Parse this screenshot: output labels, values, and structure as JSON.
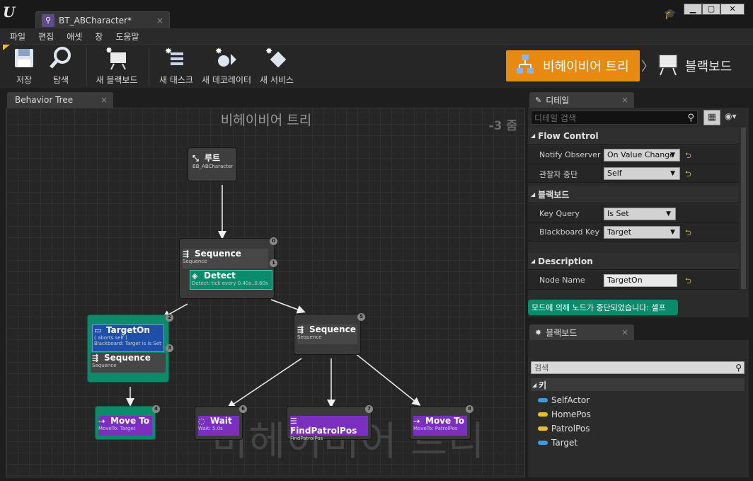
{
  "window": {
    "doc_tab": "BT_ABCharacter*",
    "doc_tab_close": "×",
    "buttons": [
      "▁",
      "▢",
      "✕"
    ]
  },
  "menu": [
    "파일",
    "편집",
    "애셋",
    "창",
    "도움말"
  ],
  "toolbar": {
    "save": "저장",
    "browse": "탐색",
    "new_blackboard": "새 블랙보드",
    "new_task": "새 태스크",
    "new_decorator": "새 데코레이터",
    "new_service": "새 서비스"
  },
  "modes": {
    "behavior_tree": "비헤이비어 트리",
    "blackboard": "블랙보드",
    "arrow": "〉"
  },
  "graph": {
    "tab": "Behavior Tree",
    "tab_close": "×",
    "title": "비헤이비어 트리",
    "zoom": "-3 줌",
    "watermark": "비헤이비어 트리",
    "root": {
      "title": "루트",
      "sub": "BB_ABCharacter"
    },
    "seq_main": {
      "title": "Sequence",
      "sub": "Sequence",
      "badge": "0"
    },
    "detect": {
      "title": "Detect",
      "sub": "Detect: tick every 0.40s..0.60s",
      "badge": "1"
    },
    "target_on": {
      "title": "TargetOn",
      "sub1": "( aborts self )",
      "sub2": "Blackboard: Target is Is Set",
      "badge_top": "2",
      "badge_mid": "3"
    },
    "seq_left": {
      "title": "Sequence",
      "sub": "Sequence"
    },
    "seq_right": {
      "title": "Sequence",
      "sub": "Sequence",
      "badge": "5"
    },
    "move_left": {
      "title": "Move To",
      "sub": "MoveTo: Target",
      "badge": "4"
    },
    "wait": {
      "title": "Wait",
      "sub": "Wait: 5.0s",
      "badge": "6"
    },
    "find": {
      "title": "FindPatrolPos",
      "sub": "FindPatrolPos",
      "badge": "7"
    },
    "move_right": {
      "title": "Move To",
      "sub": "MoveTo: PatrolPos",
      "badge": "8"
    }
  },
  "details": {
    "tab": "디테일",
    "tab_close": "×",
    "search_placeholder": "디테일 검색",
    "groups": {
      "flow": "Flow Control",
      "blackboard": "블랙보드",
      "description": "Description"
    },
    "rows": {
      "notify_label": "Notify Observer",
      "notify_value": "On Value Change",
      "abort_label": "관찰자 중단",
      "abort_value": "Self",
      "keyquery_label": "Key Query",
      "keyquery_value": "Is Set",
      "bbkey_label": "Blackboard Key",
      "bbkey_value": "Target",
      "nodename_label": "Node Name",
      "nodename_value": "TargetOn"
    },
    "warning": "모드에 의해 노드가 중단되었습니다: 셀프"
  },
  "blackboard": {
    "tab": "블랙보드",
    "tab_close": "×",
    "search_placeholder": "검색",
    "group": "키",
    "keys": [
      {
        "name": "SelfActor",
        "color": "#3a9ce8"
      },
      {
        "name": "HomePos",
        "color": "#e8c020"
      },
      {
        "name": "PatrolPos",
        "color": "#e8c020"
      },
      {
        "name": "Target",
        "color": "#3a9ce8"
      }
    ]
  },
  "colors": {
    "accent_orange": "#e88a12",
    "decorator_blue": "#1f4fa8",
    "service_green": "#0a8c6c",
    "task_purple": "#7b2fbf",
    "composite_grey": "#3a3a3a"
  }
}
